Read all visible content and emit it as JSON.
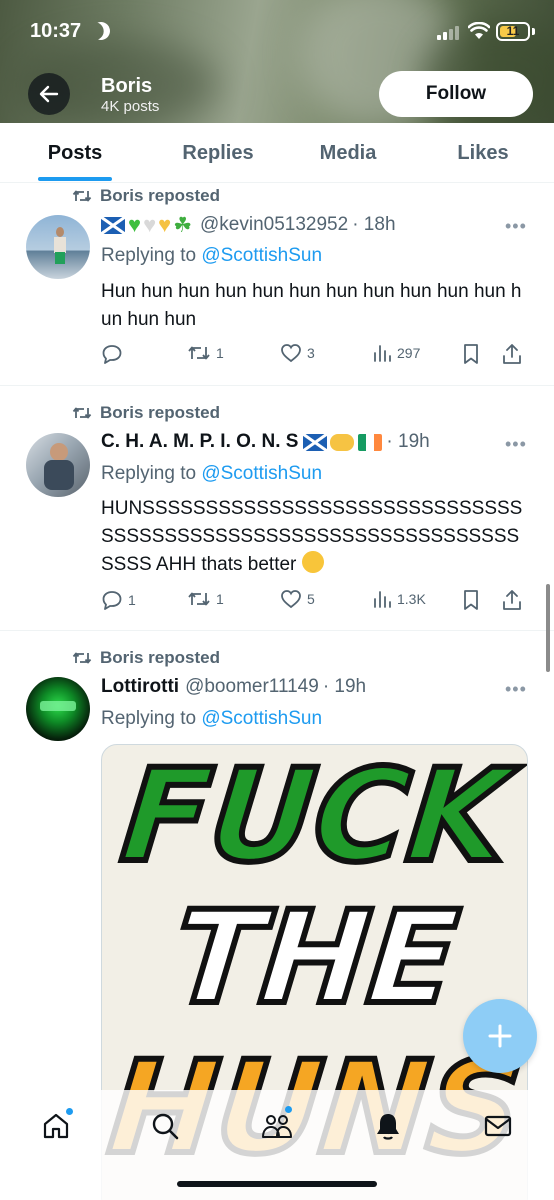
{
  "status_bar": {
    "time": "10:37",
    "battery": "11"
  },
  "header": {
    "name": "Boris",
    "posts_count": "4K posts",
    "follow_label": "Follow"
  },
  "tabs": [
    {
      "label": "Posts",
      "active": true
    },
    {
      "label": "Replies",
      "active": false
    },
    {
      "label": "Media",
      "active": false
    },
    {
      "label": "Likes",
      "active": false
    }
  ],
  "posts": [
    {
      "repost_label": "Boris reposted",
      "display_name": "",
      "name_emojis": [
        "scotland-flag",
        "green-heart",
        "white-heart",
        "yellow-heart",
        "shamrock"
      ],
      "handle": "@kevin05132952",
      "time": "· 18h",
      "replying_prefix": "Replying to ",
      "replying_to": "@ScottishSun",
      "text": "Hun hun hun hun hun hun hun hun hun hun hun hun hun hun",
      "replies": "",
      "reposts": "1",
      "likes": "3",
      "views": "297"
    },
    {
      "repost_label": "Boris reposted",
      "display_name": "C. H. A. M. P. I. O. N. S",
      "name_emojis": [
        "scotland-flag",
        "handshake",
        "ireland-flag"
      ],
      "handle": "",
      "time": "· 19h",
      "replying_prefix": "Replying to ",
      "replying_to": "@ScottishSun",
      "text": "HUNSSSSSSSSSSSSSSSSSSSSSSSSSSSSSSSSSSSSSSSSSSSSSSSSSSSSSSSSSSSSSSSSSSS AHH thats better",
      "text_emoji": "rolling-laughing-face",
      "replies": "1",
      "reposts": "1",
      "likes": "5",
      "views": "1.3K"
    },
    {
      "repost_label": "Boris reposted",
      "display_name": "Lottirotti",
      "handle": "@boomer11149",
      "time": "· 19h",
      "replying_prefix": "Replying to ",
      "replying_to": "@ScottishSun",
      "media_words": [
        "FUCK",
        "THE",
        "HUNS"
      ]
    }
  ],
  "colors": {
    "accent": "#1d9bf0",
    "muted": "#536471",
    "text": "#0f1419"
  },
  "icons": [
    "back-arrow-icon",
    "repost-icon",
    "reply-icon",
    "like-icon",
    "views-icon",
    "bookmark-icon",
    "share-icon",
    "more-icon",
    "plus-icon",
    "home-icon",
    "search-icon",
    "communities-icon",
    "notifications-icon",
    "messages-icon"
  ]
}
